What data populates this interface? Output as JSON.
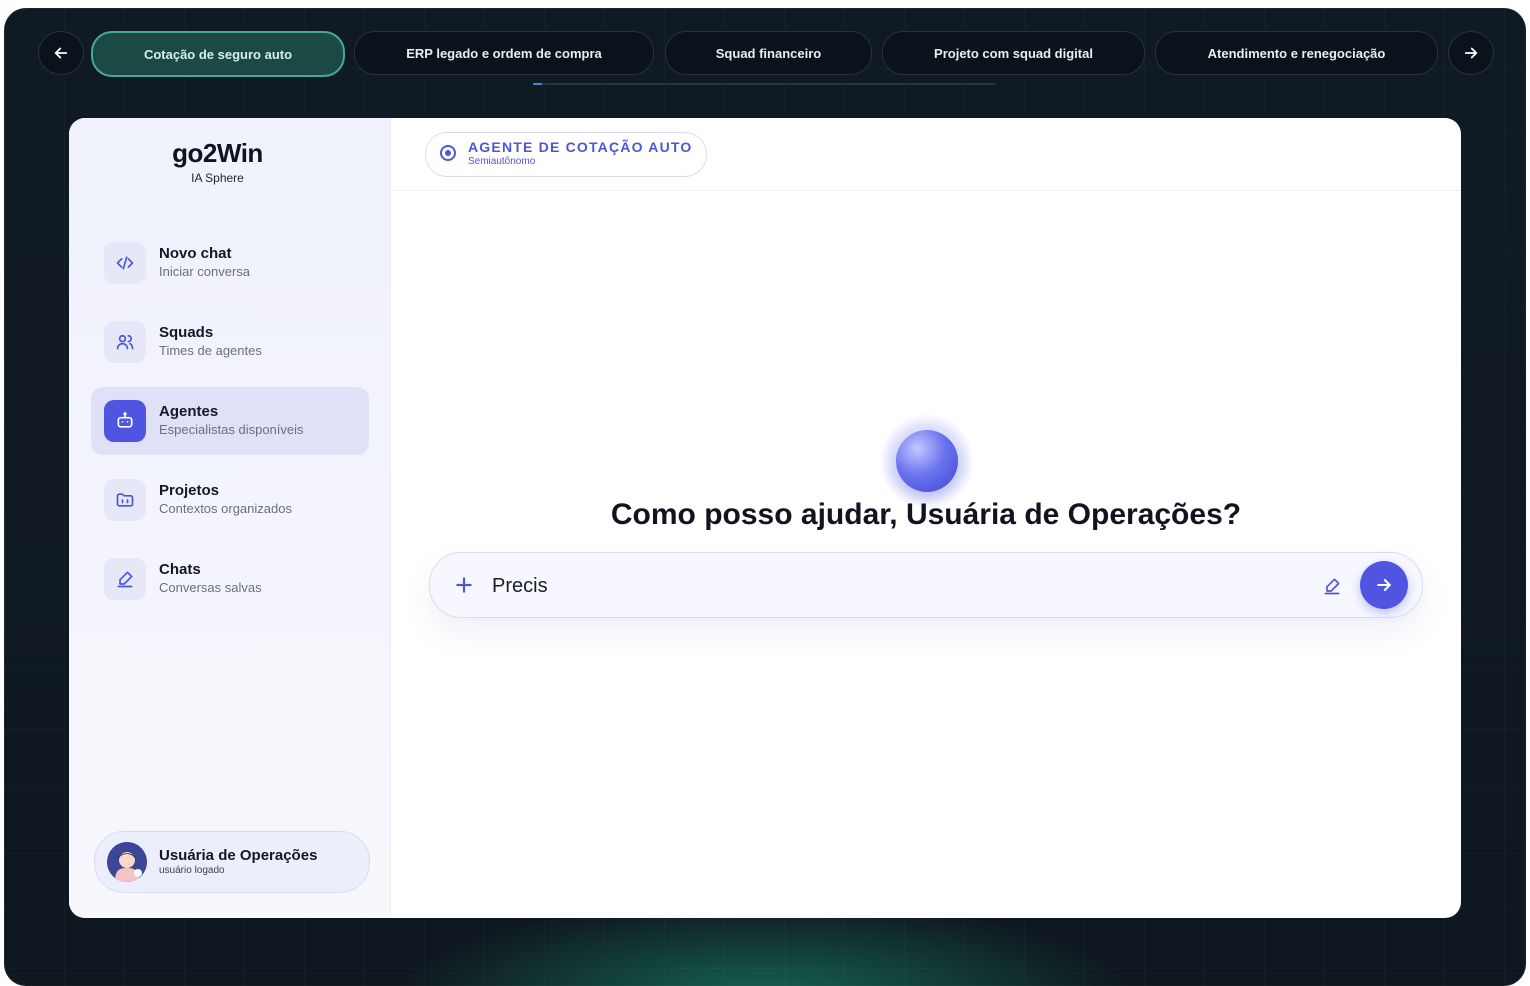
{
  "scenario_tabs": [
    {
      "label": "Cotação de seguro auto",
      "active": true
    },
    {
      "label": "ERP legado e ordem de compra",
      "active": false
    },
    {
      "label": "Squad financeiro",
      "active": false
    },
    {
      "label": "Projeto com squad digital",
      "active": false
    },
    {
      "label": "Atendimento e renegociação",
      "active": false
    }
  ],
  "nav_arrows": {
    "prev_icon": "arrow-left-icon",
    "next_icon": "arrow-right-icon"
  },
  "progress": {
    "fraction": 0.02
  },
  "brand": {
    "name": "go2Win",
    "subtitle": "IA Sphere"
  },
  "sidebar": {
    "items": [
      {
        "title": "Novo chat",
        "subtitle": "Iniciar conversa",
        "icon": "code-icon",
        "active": false
      },
      {
        "title": "Squads",
        "subtitle": "Times de agentes",
        "icon": "users-icon",
        "active": false
      },
      {
        "title": "Agentes",
        "subtitle": "Especialistas disponíveis",
        "icon": "bot-icon",
        "active": true
      },
      {
        "title": "Projetos",
        "subtitle": "Contextos organizados",
        "icon": "folder-icon",
        "active": false
      },
      {
        "title": "Chats",
        "subtitle": "Conversas salvas",
        "icon": "pen-icon",
        "active": false
      }
    ]
  },
  "user": {
    "name": "Usuária de Operações",
    "status": "usuário logado"
  },
  "agent": {
    "title": "AGENTE DE COTAÇÃO AUTO",
    "mode": "Semiautônomo"
  },
  "main": {
    "greeting": "Como posso ajudar, Usuária de Operações?"
  },
  "composer": {
    "value": "Precis",
    "placeholder": ""
  },
  "colors": {
    "accent": "#4f55e0",
    "active_tab": "#1b4a45",
    "active_tab_border": "#46a898",
    "background": "#0f1a22"
  }
}
